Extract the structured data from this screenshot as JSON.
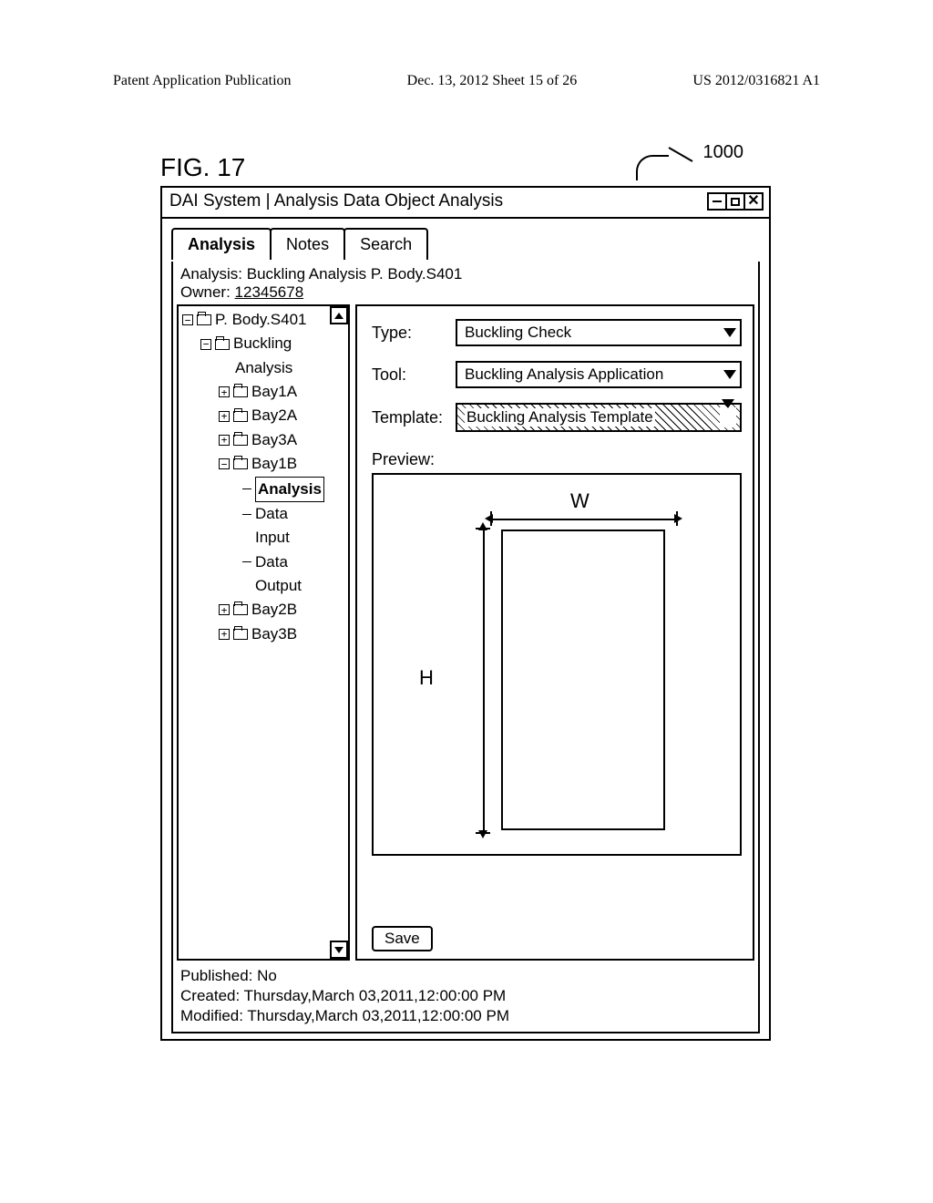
{
  "page_header": {
    "left": "Patent Application Publication",
    "center": "Dec. 13, 2012  Sheet 15 of 26",
    "right": "US 2012/0316821 A1"
  },
  "figure_label": "FIG. 17",
  "callout_number": "1000",
  "window": {
    "title": "DAI System | Analysis Data Object Analysis"
  },
  "tabs": {
    "analysis": "Analysis",
    "notes": "Notes",
    "search": "Search"
  },
  "meta": {
    "analysis_label": "Analysis:",
    "analysis_value": "Buckling Analysis P. Body.S401",
    "owner_label": "Owner:",
    "owner_value": "12345678"
  },
  "tree": {
    "root": "P. Body.S401",
    "buckling": "Buckling",
    "analysis_lbl": "Analysis",
    "bay1a": "Bay1A",
    "bay2a": "Bay2A",
    "bay3a": "Bay3A",
    "bay1b": "Bay1B",
    "analysis_leaf": "Analysis",
    "data_input": "Data Input",
    "data_output": "Data Output",
    "bay2b": "Bay2B",
    "bay3b": "Bay3B"
  },
  "detail": {
    "type_label": "Type:",
    "type_value": "Buckling Check",
    "tool_label": "Tool:",
    "tool_value": "Buckling Analysis Application",
    "template_label": "Template:",
    "template_value": "Buckling Analysis Template",
    "preview_label": "Preview:",
    "w_label": "W",
    "h_label": "H",
    "save": "Save"
  },
  "footer": {
    "published": "Published: No",
    "created": "Created: Thursday,March 03,2011,12:00:00 PM",
    "modified": "Modified: Thursday,March 03,2011,12:00:00 PM"
  }
}
